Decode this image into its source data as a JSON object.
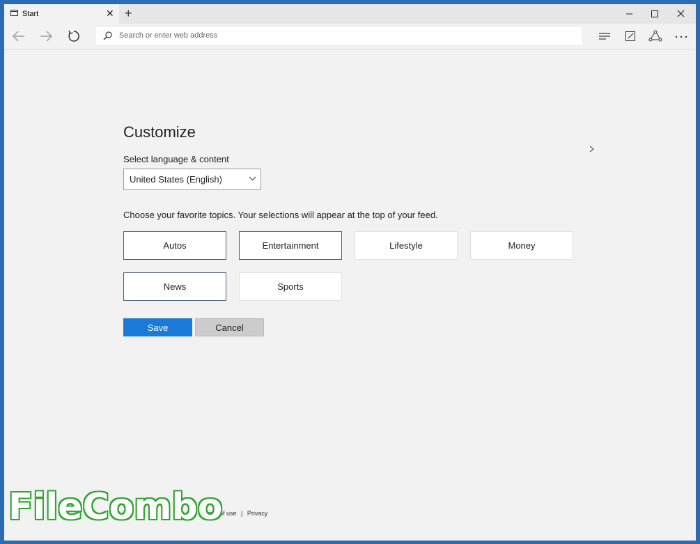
{
  "browser": {
    "tab_title": "Start",
    "new_tab_icon": "+",
    "close_tab_icon": "✕",
    "address_placeholder": "Search or enter web address"
  },
  "customize": {
    "title": "Customize",
    "language_label": "Select language & content",
    "language_value": "United States (English)",
    "topics_label": "Choose your favorite topics. Your selections will appear at the top of your feed.",
    "topics": [
      {
        "label": "Autos",
        "selected": true
      },
      {
        "label": "Entertainment",
        "selected": true
      },
      {
        "label": "Lifestyle",
        "selected": false
      },
      {
        "label": "Money",
        "selected": false
      },
      {
        "label": "News",
        "selected": true
      },
      {
        "label": "Sports",
        "selected": false
      }
    ],
    "save_label": "Save",
    "cancel_label": "Cancel"
  },
  "footer": {
    "terms": "Terms of use",
    "separator": "|",
    "privacy": "Privacy"
  },
  "watermark": "FileCombo",
  "colors": {
    "accent": "#1a7ad8",
    "selected_border": "#4a5d7a",
    "watermark_green": "#2fa52f"
  }
}
